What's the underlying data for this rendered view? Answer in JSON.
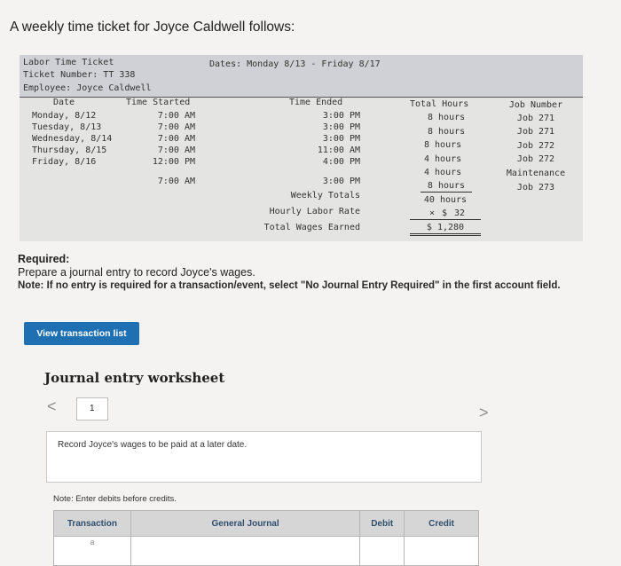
{
  "intro": "A weekly time ticket for Joyce Caldwell follows:",
  "ticket": {
    "label": "Labor Time Ticket",
    "number": "Ticket Number: TT 338",
    "employee": "Employee: Joyce Caldwell",
    "dates": "Dates: Monday 8/13 - Friday 8/17",
    "columns": {
      "date": "Date",
      "started": "Time Started",
      "ended": "Time Ended",
      "total": "Total Hours",
      "job": "Job Number"
    },
    "dates_col": [
      "Monday, 8/12",
      "Tuesday, 8/13",
      "Wednesday, 8/14",
      "Thursday, 8/15",
      "Friday, 8/16"
    ],
    "started": [
      "7:00 AM",
      "7:00 AM",
      "7:00 AM",
      "7:00 AM",
      "12:00 PM",
      "7:00 AM"
    ],
    "ended": [
      "3:00 PM",
      "3:00 PM",
      "3:00 PM",
      "11:00 AM",
      "4:00 PM",
      "3:00 PM"
    ],
    "hours": [
      "8 hours",
      "8 hours",
      "8 hours",
      "4 hours",
      "4 hours",
      "8 hours"
    ],
    "jobs": [
      "Job 271",
      "Job 271",
      "Job 272",
      "Job 272",
      "Maintenance",
      "Job 273"
    ],
    "weekly_totals_label": "Weekly Totals",
    "weekly_totals_value": "40 hours",
    "rate_label": "Hourly Labor Rate",
    "rate_prefix": "×",
    "rate_dollar": "$",
    "rate_value": "32",
    "wages_label": "Total Wages Earned",
    "wages_value": "$ 1,280"
  },
  "required": {
    "label": "Required:",
    "text": "Prepare a journal entry to record Joyce's wages.",
    "note": "Note: If no entry is required for a transaction/event, select \"No Journal Entry Required\" in the first account field."
  },
  "buttons": {
    "view_transaction_list": "View transaction list"
  },
  "worksheet": {
    "title": "Journal entry worksheet",
    "prev": "<",
    "next": ">",
    "page": "1",
    "record_text": "Record Joyce's wages to be paid at a later date.",
    "note_debits": "Note: Enter debits before credits.",
    "headers": {
      "transaction": "Transaction",
      "general_journal": "General Journal",
      "debit": "Debit",
      "credit": "Credit"
    },
    "row_label": "a"
  }
}
